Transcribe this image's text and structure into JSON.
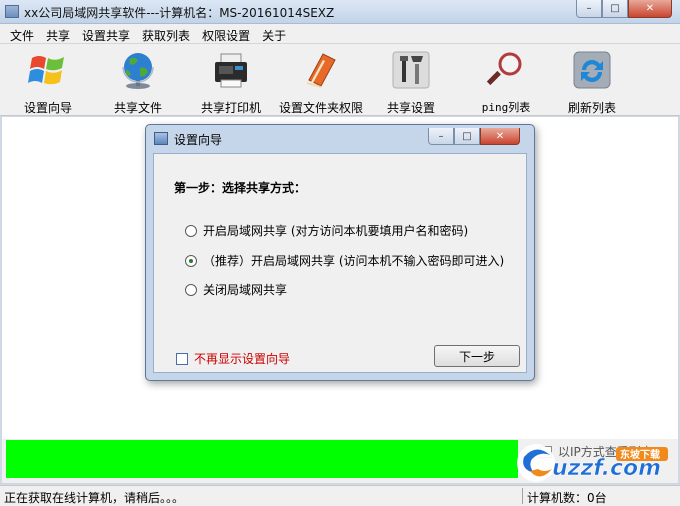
{
  "window": {
    "title": "xx公司局域网共享软件---计算机名：MS-20161014SEXZ",
    "min_glyph": "–",
    "max_glyph": "□",
    "close_glyph": "✕"
  },
  "menu": [
    "文件",
    "共享",
    "设置共享",
    "获取列表",
    "权限设置",
    "关于"
  ],
  "toolbar": [
    {
      "label": "设置向导",
      "icon": "windows-logo-icon"
    },
    {
      "label": "共享文件",
      "icon": "globe-icon"
    },
    {
      "label": "共享打印机",
      "icon": "printer-icon"
    },
    {
      "label": "设置文件夹权限",
      "icon": "book-icon"
    },
    {
      "label": "共享设置",
      "icon": "tools-icon"
    },
    {
      "label": "ping列表",
      "icon": "magnifier-icon"
    },
    {
      "label": "刷新列表",
      "icon": "refresh-icon"
    }
  ],
  "dialog": {
    "title": "设置向导",
    "step_title": "第一步：选择共享方式：",
    "options": [
      {
        "label": "开启局域网共享 (对方访问本机要填用户名和密码)",
        "checked": false
      },
      {
        "label": "（推荐）开启局域网共享 (访问本机不输入密码即可进入)",
        "checked": true
      },
      {
        "label": "关闭局域网共享",
        "checked": false
      }
    ],
    "dont_show_label": "不再显示设置向导",
    "next_button": "下一步"
  },
  "bottom": {
    "ip_checkbox_label": "以IP方式查看列表",
    "logo_text": "uzzf.com",
    "logo_badge": "东坡下载"
  },
  "status": {
    "left": "正在获取在线计算机，请稍后。。。",
    "right": "计算机数：0台"
  },
  "colors": {
    "progress_green": "#00ff00",
    "close_red": "#c8452f",
    "warn_text": "#cc0000"
  }
}
